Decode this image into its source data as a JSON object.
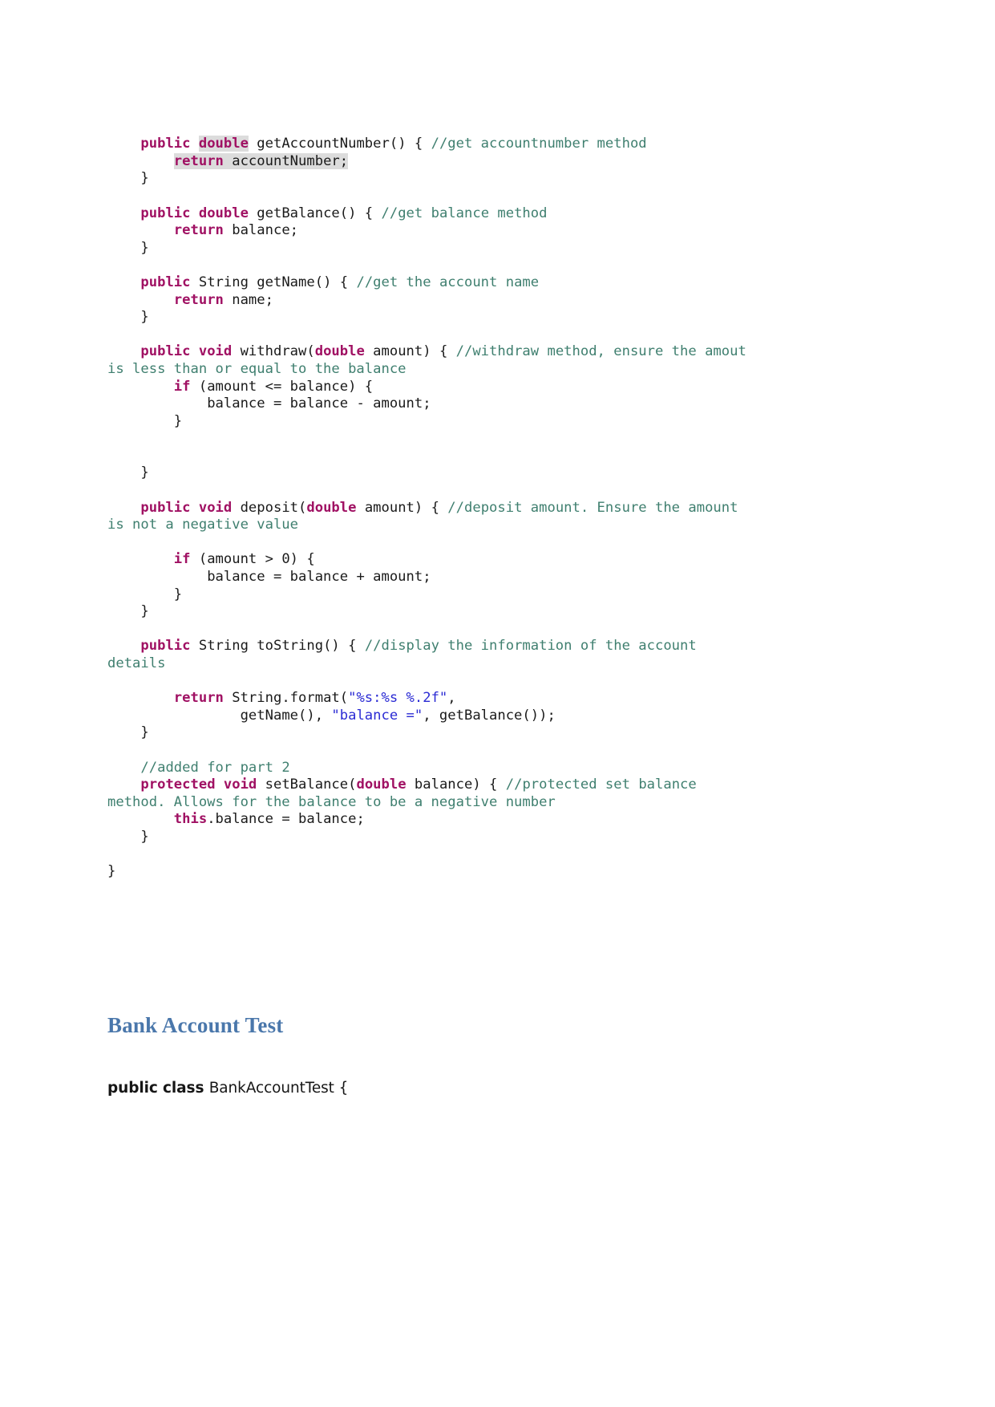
{
  "document": {
    "code_block": {
      "language": "java",
      "lines": [
        {
          "id": "l1",
          "indent": "    ",
          "segments": [
            {
              "t": "public ",
              "c": "kw"
            },
            {
              "t": "double",
              "c": "kw",
              "hl": true
            },
            {
              "t": " getAccountNumber() { ",
              "c": "plain"
            },
            {
              "t": "//get accountnumber method",
              "c": "cmt"
            }
          ]
        },
        {
          "id": "l2",
          "indent": "        ",
          "segments": [
            {
              "t": "return",
              "c": "kw",
              "hl": true
            },
            {
              "t": " accountNumber;",
              "c": "plain",
              "hl": true
            }
          ]
        },
        {
          "id": "l3",
          "indent": "    ",
          "segments": [
            {
              "t": "}",
              "c": "plain"
            }
          ]
        },
        {
          "id": "l4",
          "indent": "",
          "segments": []
        },
        {
          "id": "l5",
          "indent": "    ",
          "segments": [
            {
              "t": "public double",
              "c": "kw"
            },
            {
              "t": " getBalance() { ",
              "c": "plain"
            },
            {
              "t": "//get balance method",
              "c": "cmt"
            }
          ]
        },
        {
          "id": "l6",
          "indent": "        ",
          "segments": [
            {
              "t": "return",
              "c": "kw"
            },
            {
              "t": " balance;",
              "c": "plain"
            }
          ]
        },
        {
          "id": "l7",
          "indent": "    ",
          "segments": [
            {
              "t": "}",
              "c": "plain"
            }
          ]
        },
        {
          "id": "l8",
          "indent": "",
          "segments": []
        },
        {
          "id": "l9",
          "indent": "    ",
          "segments": [
            {
              "t": "public",
              "c": "kw"
            },
            {
              "t": " String getName() { ",
              "c": "plain"
            },
            {
              "t": "//get the account name",
              "c": "cmt"
            }
          ]
        },
        {
          "id": "l10",
          "indent": "        ",
          "segments": [
            {
              "t": "return",
              "c": "kw"
            },
            {
              "t": " name;",
              "c": "plain"
            }
          ]
        },
        {
          "id": "l11",
          "indent": "    ",
          "segments": [
            {
              "t": "}",
              "c": "plain"
            }
          ]
        },
        {
          "id": "l12",
          "indent": "",
          "segments": []
        },
        {
          "id": "l13",
          "indent": "    ",
          "segments": [
            {
              "t": "public void",
              "c": "kw"
            },
            {
              "t": " withdraw(",
              "c": "plain"
            },
            {
              "t": "double",
              "c": "kw"
            },
            {
              "t": " amount) { ",
              "c": "plain"
            },
            {
              "t": "//withdraw method, ensure the amout is less than or equal to the balance",
              "c": "cmt"
            }
          ]
        },
        {
          "id": "l14",
          "indent": "        ",
          "segments": [
            {
              "t": "if",
              "c": "kw"
            },
            {
              "t": " (amount <= balance) {",
              "c": "plain"
            }
          ]
        },
        {
          "id": "l15",
          "indent": "            ",
          "segments": [
            {
              "t": "balance = balance - amount;",
              "c": "plain"
            }
          ]
        },
        {
          "id": "l16",
          "indent": "        ",
          "segments": [
            {
              "t": "}",
              "c": "plain"
            }
          ]
        },
        {
          "id": "l17",
          "indent": "",
          "segments": []
        },
        {
          "id": "l18",
          "indent": "",
          "segments": []
        },
        {
          "id": "l19",
          "indent": "    ",
          "segments": [
            {
              "t": "}",
              "c": "plain"
            }
          ]
        },
        {
          "id": "l20",
          "indent": "",
          "segments": []
        },
        {
          "id": "l21",
          "indent": "    ",
          "segments": [
            {
              "t": "public void",
              "c": "kw"
            },
            {
              "t": " deposit(",
              "c": "plain"
            },
            {
              "t": "double",
              "c": "kw"
            },
            {
              "t": " amount) { ",
              "c": "plain"
            },
            {
              "t": "//deposit amount. Ensure the amount is not a negative value",
              "c": "cmt"
            }
          ]
        },
        {
          "id": "l22",
          "indent": "",
          "segments": []
        },
        {
          "id": "l23",
          "indent": "        ",
          "segments": [
            {
              "t": "if",
              "c": "kw"
            },
            {
              "t": " (amount > 0) {",
              "c": "plain"
            }
          ]
        },
        {
          "id": "l24",
          "indent": "            ",
          "segments": [
            {
              "t": "balance = balance + amount;",
              "c": "plain"
            }
          ]
        },
        {
          "id": "l25",
          "indent": "        ",
          "segments": [
            {
              "t": "}",
              "c": "plain"
            }
          ]
        },
        {
          "id": "l26",
          "indent": "    ",
          "segments": [
            {
              "t": "}",
              "c": "plain"
            }
          ]
        },
        {
          "id": "l27",
          "indent": "",
          "segments": []
        },
        {
          "id": "l28",
          "indent": "    ",
          "segments": [
            {
              "t": "public",
              "c": "kw"
            },
            {
              "t": " String toString() { ",
              "c": "plain"
            },
            {
              "t": "//display the information of the account details",
              "c": "cmt"
            }
          ]
        },
        {
          "id": "l29",
          "indent": "",
          "segments": []
        },
        {
          "id": "l30",
          "indent": "        ",
          "segments": [
            {
              "t": "return",
              "c": "kw"
            },
            {
              "t": " String.format(",
              "c": "plain"
            },
            {
              "t": "\"%s:%s %.2f\"",
              "c": "str"
            },
            {
              "t": ",",
              "c": "plain"
            }
          ]
        },
        {
          "id": "l31",
          "indent": "                ",
          "segments": [
            {
              "t": "getName(), ",
              "c": "plain"
            },
            {
              "t": "\"balance =\"",
              "c": "str"
            },
            {
              "t": ", getBalance());",
              "c": "plain"
            }
          ]
        },
        {
          "id": "l32",
          "indent": "    ",
          "segments": [
            {
              "t": "}",
              "c": "plain"
            }
          ]
        },
        {
          "id": "l33",
          "indent": "",
          "segments": []
        },
        {
          "id": "l34",
          "indent": "    ",
          "segments": [
            {
              "t": "//added for part 2",
              "c": "cmt"
            }
          ]
        },
        {
          "id": "l35",
          "indent": "    ",
          "segments": [
            {
              "t": "protected void",
              "c": "kw"
            },
            {
              "t": " setBalance(",
              "c": "plain"
            },
            {
              "t": "double",
              "c": "kw"
            },
            {
              "t": " balance) { ",
              "c": "plain"
            },
            {
              "t": "//protected set balance method. Allows for the balance to be a negative number",
              "c": "cmt"
            }
          ]
        },
        {
          "id": "l36",
          "indent": "        ",
          "segments": [
            {
              "t": "this",
              "c": "kw"
            },
            {
              "t": ".balance = balance;",
              "c": "plain"
            }
          ]
        },
        {
          "id": "l37",
          "indent": "    ",
          "segments": [
            {
              "t": "}",
              "c": "plain"
            }
          ]
        },
        {
          "id": "l38",
          "indent": "",
          "segments": []
        },
        {
          "id": "l39",
          "indent": "",
          "segments": [
            {
              "t": "}",
              "c": "plain"
            }
          ]
        }
      ]
    },
    "heading": {
      "text": "Bank Account Test",
      "color": "#4a77ab"
    },
    "paragraph": {
      "bold_prefix": "public class ",
      "rest": "BankAccountTest {"
    }
  },
  "theme": {
    "background": "#ffffff",
    "keyword_color": "#a01163",
    "comment_color": "#3f7f6f",
    "string_color": "#2b2bd4",
    "plain_color": "#1a1a1a",
    "highlight_color": "#dcdcdc",
    "heading_color": "#4a77ab"
  }
}
